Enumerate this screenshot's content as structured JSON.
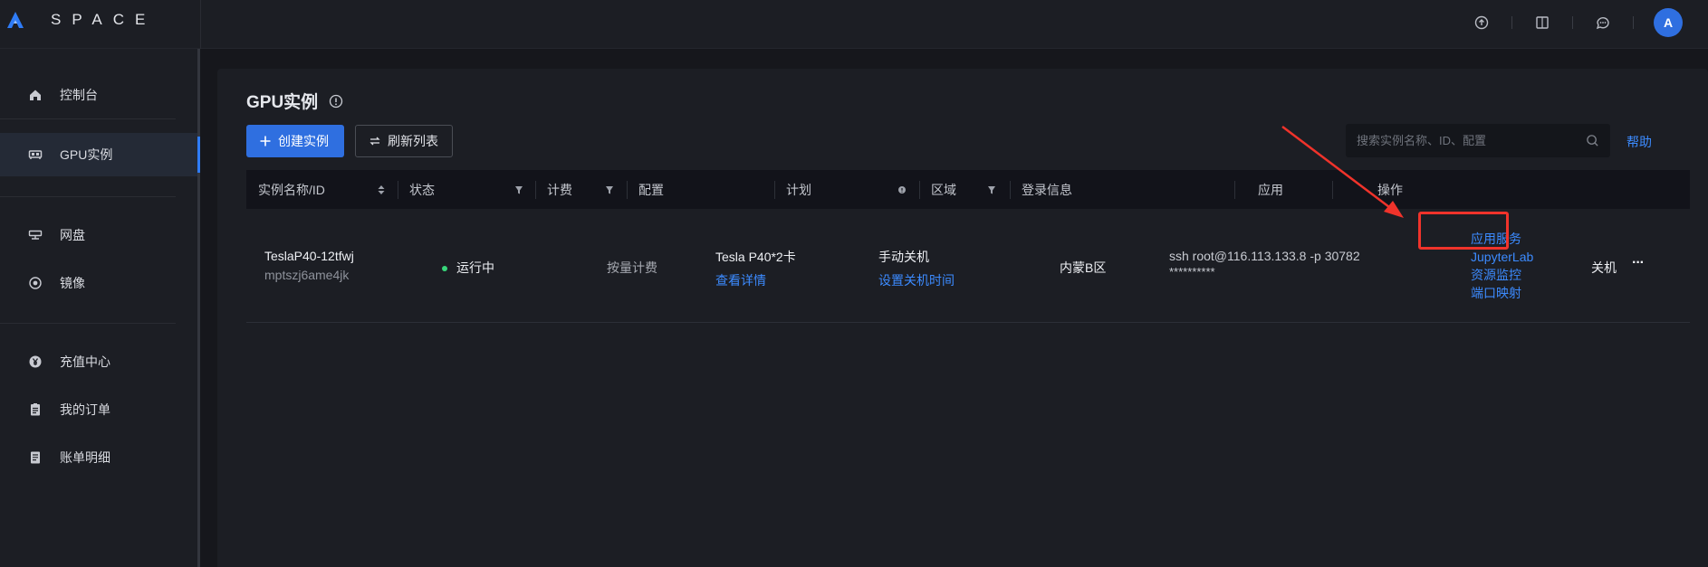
{
  "brand": {
    "name": "SPACE",
    "accent": "#2f7cf6"
  },
  "topbar": {
    "icons": [
      "upload-icon",
      "book-icon",
      "chat-icon"
    ],
    "avatar_letter": "A"
  },
  "sidebar": {
    "items": [
      {
        "label": "控制台",
        "icon": "home-icon"
      },
      {
        "label": "GPU实例",
        "icon": "gpu-icon",
        "active": true
      },
      {
        "label": "网盘",
        "icon": "disk-icon"
      },
      {
        "label": "镜像",
        "icon": "mirror-icon"
      },
      {
        "label": "充值中心",
        "icon": "yen-icon"
      },
      {
        "label": "我的订单",
        "icon": "orders-icon"
      },
      {
        "label": "账单明细",
        "icon": "bill-icon"
      }
    ]
  },
  "page": {
    "title": "GPU实例",
    "create_button": "创建实例",
    "refresh_button": "刷新列表",
    "search_placeholder": "搜索实例名称、ID、配置",
    "help": "帮助"
  },
  "table": {
    "columns": [
      "实例名称/ID",
      "状态",
      "计费",
      "配置",
      "计划",
      "区域",
      "登录信息",
      "应用",
      "操作"
    ],
    "rows": [
      {
        "name": "TeslaP40-12tfwj",
        "id": "mptszj6ame4jk",
        "status": "运行中",
        "billing": "按量计费",
        "config": "Tesla P40*2卡",
        "config_link": "查看详情",
        "plan": "手动关机",
        "plan_link": "设置关机时间",
        "region": "内蒙B区",
        "login_cmd": "ssh root@116.113.133.8 -p 30782",
        "login_pass": "**********",
        "apps": [
          "应用服务",
          "JupyterLab",
          "资源监控",
          "端口映射"
        ],
        "action": "关机",
        "more": "···"
      }
    ]
  }
}
